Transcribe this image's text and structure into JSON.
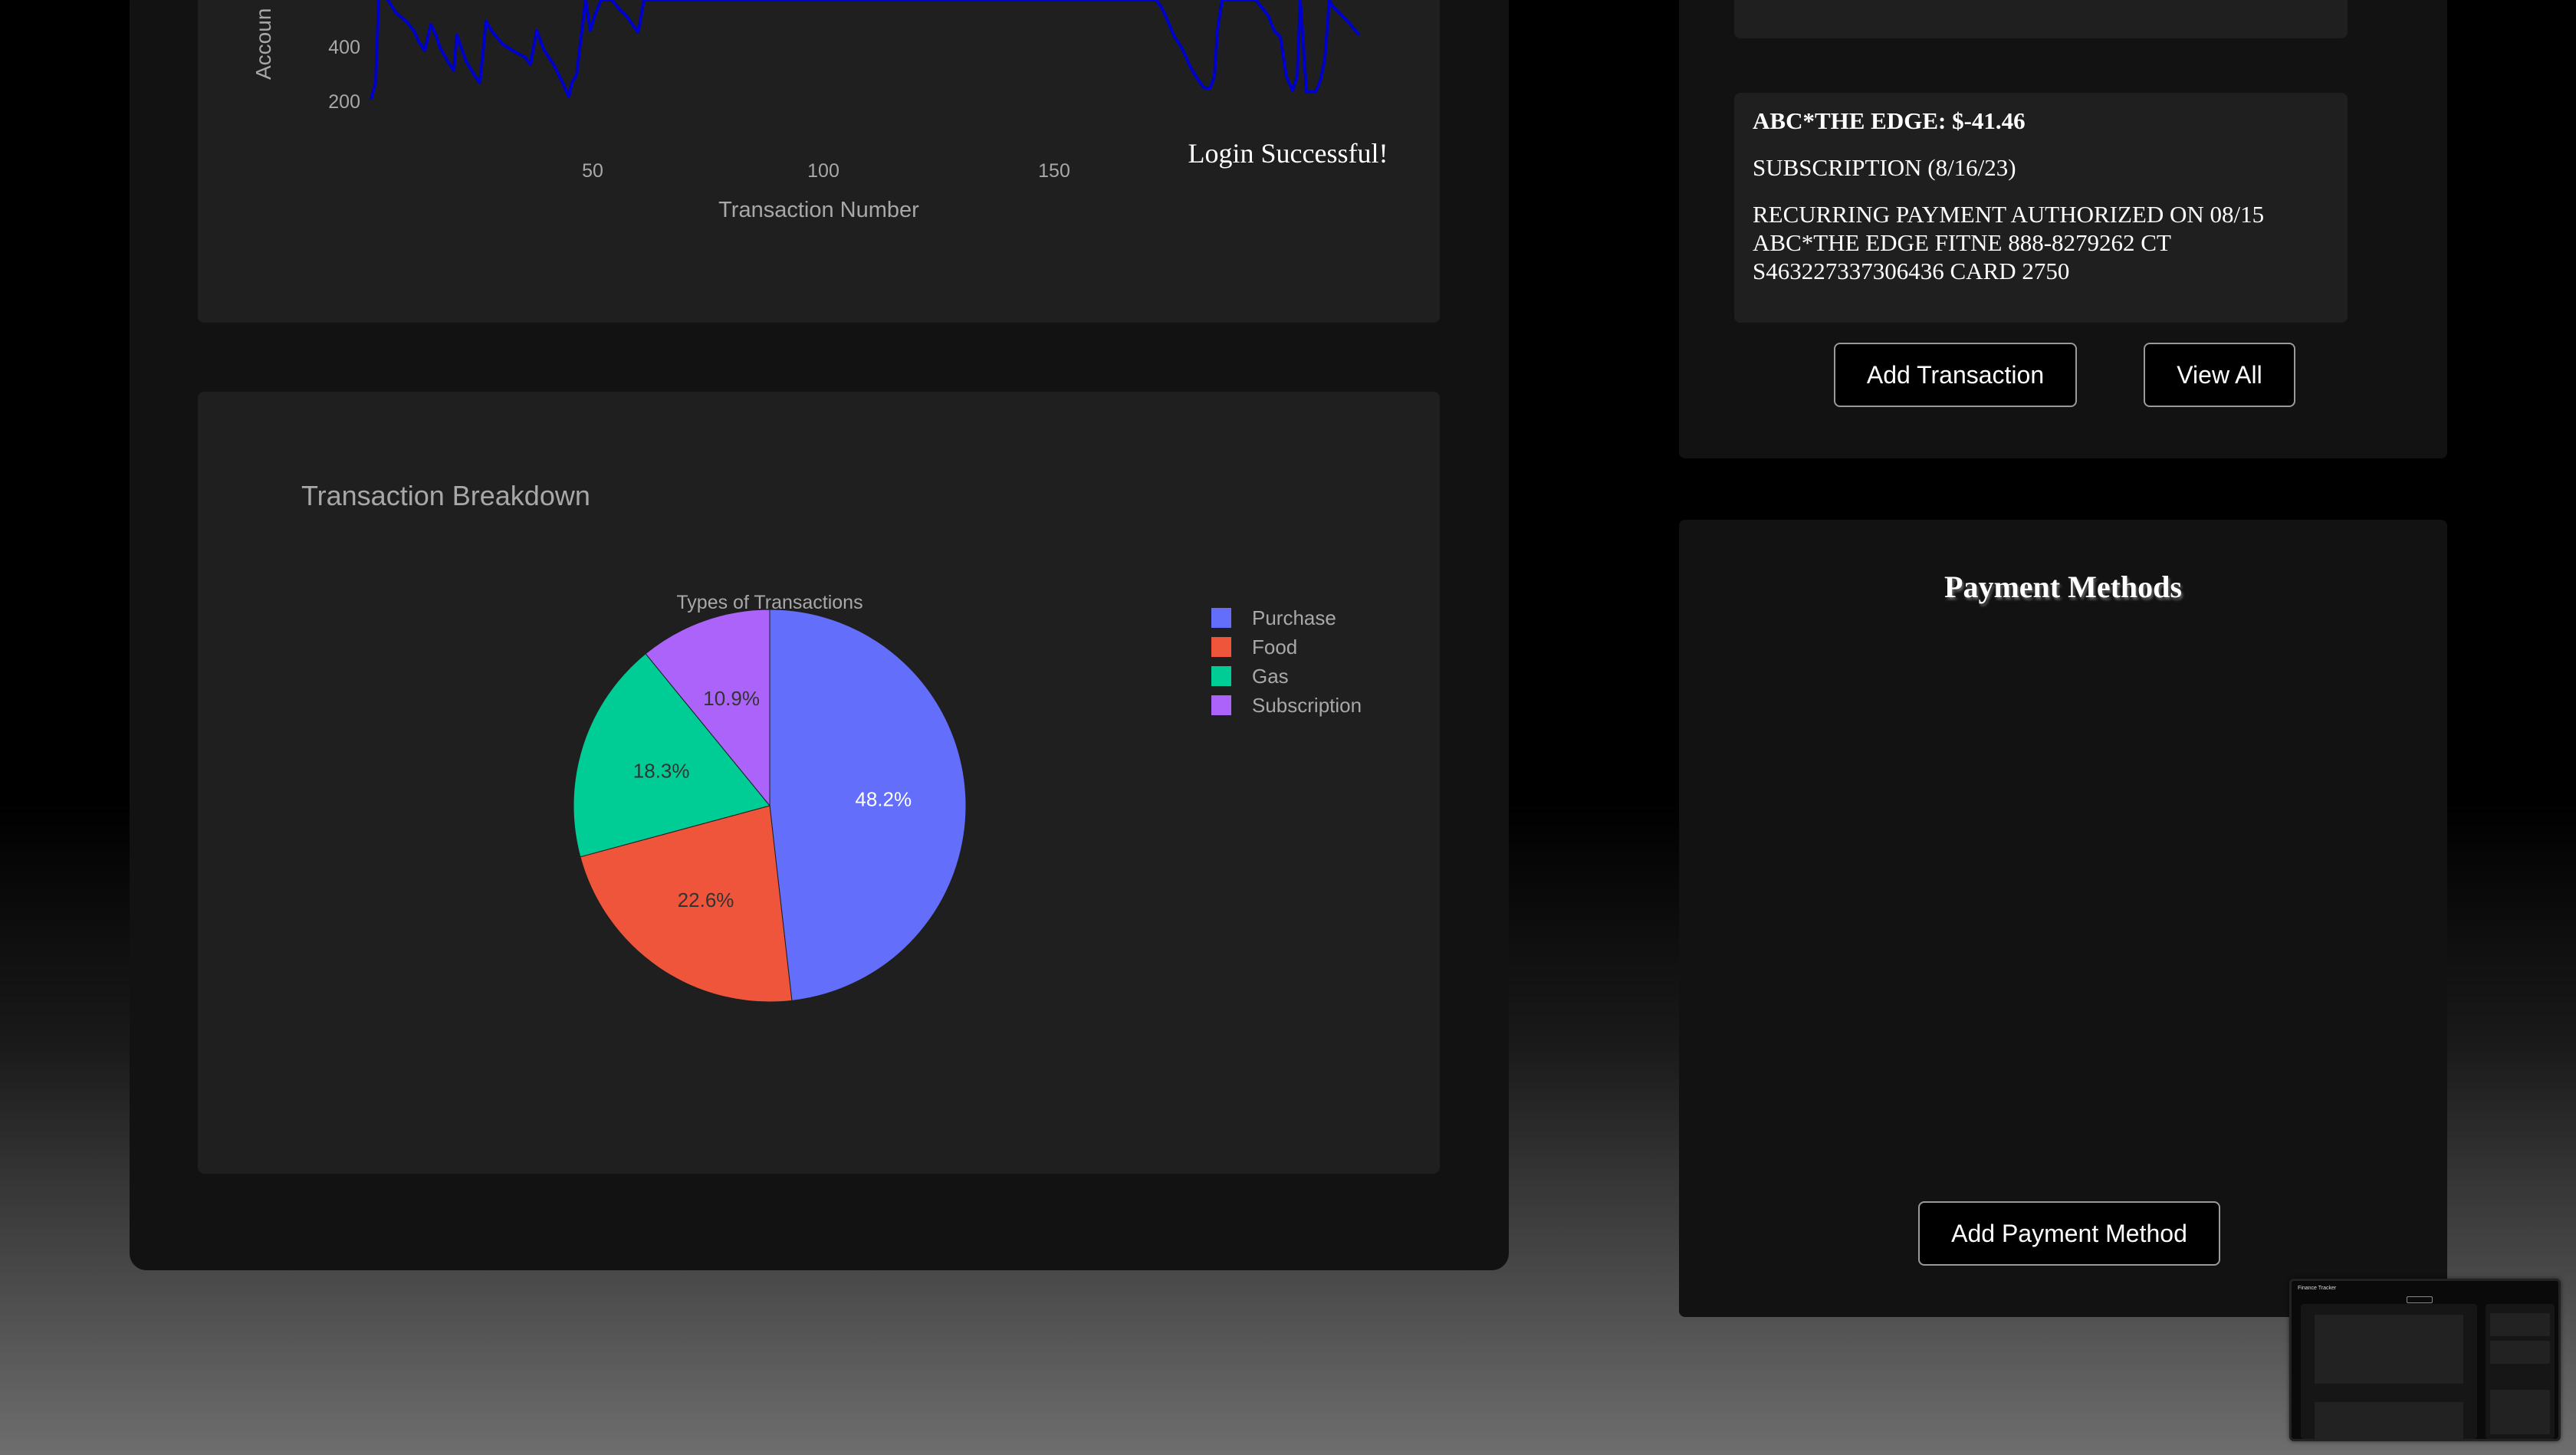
{
  "line_chart": {
    "ylabel": "Accoun",
    "y_ticks": [
      "400",
      "200"
    ],
    "x_ticks": [
      "50",
      "100",
      "150"
    ],
    "xlabel": "Transaction Number",
    "line_color": "#0000cc"
  },
  "toast": {
    "text": "Login Successful!"
  },
  "breakdown": {
    "title": "Transaction Breakdown",
    "pie_title": "Types of Transactions"
  },
  "chart_data": {
    "type": "pie",
    "title": "Types of Transactions",
    "labels": [
      "Purchase",
      "Food",
      "Gas",
      "Subscription"
    ],
    "values": [
      48.2,
      22.6,
      18.3,
      10.9
    ],
    "value_labels": [
      "48.2%",
      "22.6%",
      "18.3%",
      "10.9%"
    ],
    "colors": [
      "#636efa",
      "#ef553b",
      "#00cc96",
      "#ab63fa"
    ],
    "legend": "top-right"
  },
  "transaction": {
    "title": "ABC*THE EDGE: $-41.46",
    "category": "SUBSCRIPTION (8/16/23)",
    "description": "RECURRING PAYMENT AUTHORIZED ON 08/15\nABC*THE EDGE FITNE 888-8279262 CT\nS463227337306436 CARD 2750"
  },
  "buttons": {
    "add_transaction": "Add Transaction",
    "view_all": "View All",
    "add_payment_method": "Add Payment Method"
  },
  "payment_methods": {
    "title": "Payment Methods"
  },
  "thumbnail": {
    "title": "Finance Tracker"
  }
}
